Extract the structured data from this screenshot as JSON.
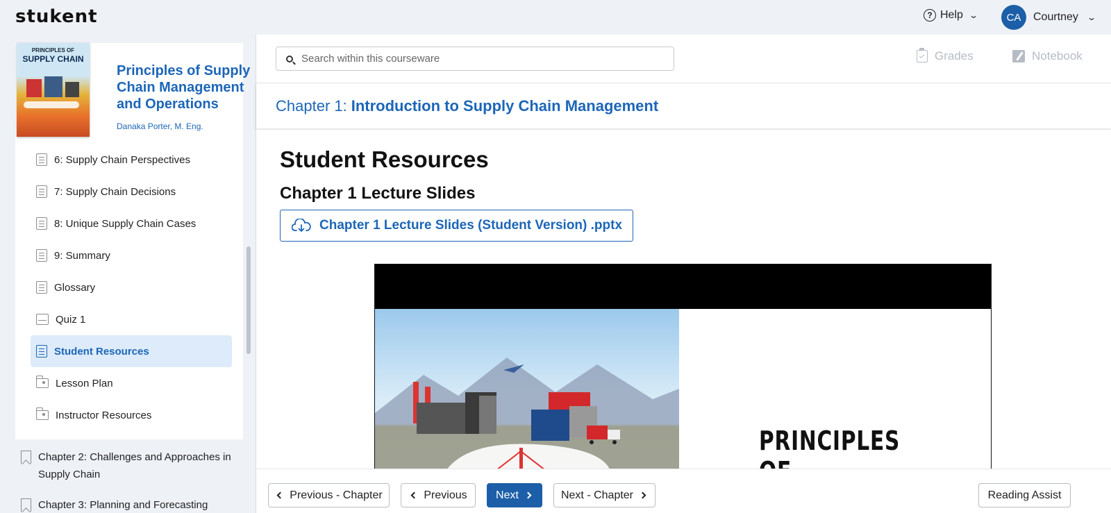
{
  "header": {
    "logo": "stukent",
    "help_label": "Help",
    "user_initials": "CA",
    "user_name": "Courtney"
  },
  "book": {
    "cover_line1": "PRINCIPLES OF",
    "cover_line2": "SUPPLY CHAIN",
    "title": "Principles of Supply Chain Management and Operations",
    "author": "Danaka Porter, M. Eng."
  },
  "toc": {
    "items": [
      {
        "label": "6: Supply Chain Perspectives",
        "icon": "document-icon"
      },
      {
        "label": "7: Supply Chain Decisions",
        "icon": "document-icon"
      },
      {
        "label": "8: Unique Supply Chain Cases",
        "icon": "document-icon"
      },
      {
        "label": "9: Summary",
        "icon": "document-icon"
      },
      {
        "label": "Glossary",
        "icon": "document-icon"
      },
      {
        "label": "Quiz 1",
        "icon": "tray-icon"
      },
      {
        "label": "Student Resources",
        "icon": "document-icon",
        "active": true
      },
      {
        "label": "Lesson Plan",
        "icon": "folder-user-icon"
      },
      {
        "label": "Instructor Resources",
        "icon": "folder-user-icon"
      }
    ],
    "chapter2": "Chapter 2: Challenges and Approaches in Supply Chain",
    "chapter3": "Chapter 3: Planning and Forecasting"
  },
  "search": {
    "placeholder": "Search within this courseware"
  },
  "tools": {
    "grades": "Grades",
    "notebook": "Notebook"
  },
  "chapter": {
    "prefix": "Chapter 1:",
    "title": "Introduction to Supply Chain Management"
  },
  "content": {
    "heading": "Student Resources",
    "subheading": "Chapter 1 Lecture Slides",
    "download_label": "Chapter 1 Lecture Slides (Student Version) .pptx",
    "slide_title": "PRINCIPLES OF"
  },
  "nav": {
    "prev_chapter": "Previous - Chapter",
    "previous": "Previous",
    "next": "Next",
    "next_chapter": "Next - Chapter",
    "reading_assist": "Reading Assist"
  },
  "colors": {
    "accent": "#1c66b8",
    "primary_button": "#1c5fa8",
    "active_bg": "#ddebfa"
  }
}
